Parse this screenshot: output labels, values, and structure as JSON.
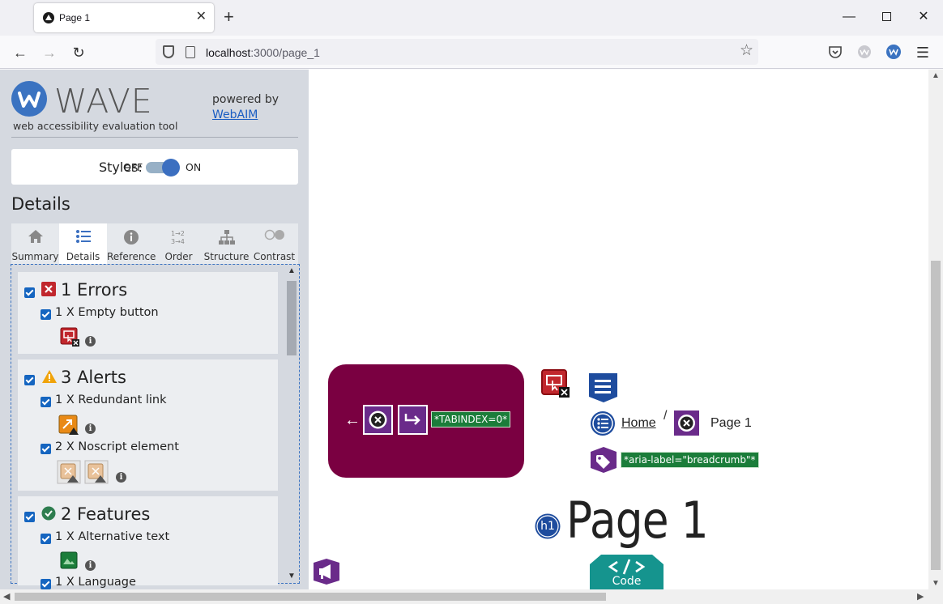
{
  "browser": {
    "tab_title": "Page 1",
    "url_host": "localhost",
    "url_path": ":3000/page_1"
  },
  "wave": {
    "name": "WAVE",
    "tagline": "web accessibility evaluation tool",
    "powered_by": "powered by",
    "webaim_link": "WebAIM",
    "styles_label": "Styles:",
    "styles_off": "OFF",
    "styles_on": "ON",
    "details_heading": "Details",
    "tabs": [
      {
        "label": "Summary"
      },
      {
        "label": "Details"
      },
      {
        "label": "Reference"
      },
      {
        "label": "Order"
      },
      {
        "label": "Structure"
      },
      {
        "label": "Contrast"
      }
    ],
    "categories": [
      {
        "title": "1 Errors",
        "items": [
          {
            "text": "1 X Empty button"
          }
        ]
      },
      {
        "title": "3 Alerts",
        "items": [
          {
            "text": "1 X Redundant link"
          },
          {
            "text": "2 X Noscript element"
          }
        ]
      },
      {
        "title": "2 Features",
        "items": [
          {
            "text": "1 X Alternative text"
          },
          {
            "text": "1 X Language"
          }
        ]
      }
    ]
  },
  "page": {
    "tabindex_badge": "*TABINDEX=0*",
    "aria_label_badge": "*aria-label=\"breadcrumb\"*",
    "breadcrumb_home": "Home",
    "breadcrumb_separator": "/",
    "breadcrumb_current": "Page 1",
    "h1_badge": "h1",
    "heading": "Page 1",
    "code_label": "Code"
  },
  "colors": {
    "wave_blue": "#3b73c1",
    "error_red": "#c1272d",
    "nav_maroon": "#7a0041",
    "structure_purple": "#6a2b8a",
    "feature_green": "#1b7d3a",
    "code_teal": "#15948e"
  }
}
